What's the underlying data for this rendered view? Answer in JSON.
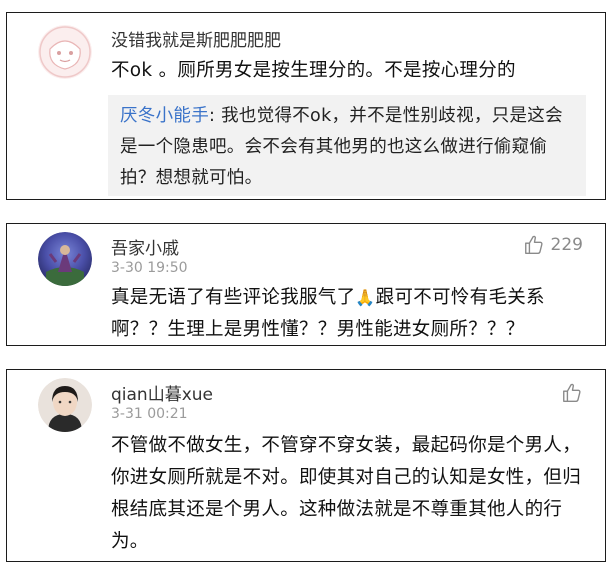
{
  "comments": [
    {
      "username": "没错我就是斯肥肥肥肥",
      "text": "不ok 。厕所男女是按生理分的。不是按心理分的",
      "reply": {
        "author": "厌冬小能手",
        "separator": ": ",
        "text": "我也觉得不ok，并不是性别歧视，只是这会是一个隐患吧。会不会有其他男的也这么做进行偷窥偷拍？想想就可怕。"
      }
    },
    {
      "username": "吾家小戚",
      "time": "3-30 19:50",
      "like_count": "229",
      "text_before_emoji": "真是无语了有些评论我服气了",
      "emoji": "🙏",
      "text_after_emoji": "跟可不可怜有毛关系啊？？生理上是男性懂？？男性能进女厕所？？？"
    },
    {
      "username": "qian山暮xue",
      "time": "3-31 00:21",
      "text": "不管做不做女生，不管穿不穿女装，最起码你是个男人，你进女厕所就是不对。即使其对自己的认知是女性，但归根结底其还是个男人。这种做法就是不尊重其他人的行为。"
    }
  ],
  "icons": {
    "like": "thumbs-up-icon",
    "reaction_emoji": "folded-hands-emoji"
  },
  "colors": {
    "reply_author": "#3a73c9",
    "timestamp": "#9b9b9b",
    "quote_bg": "#f2f2f2"
  }
}
